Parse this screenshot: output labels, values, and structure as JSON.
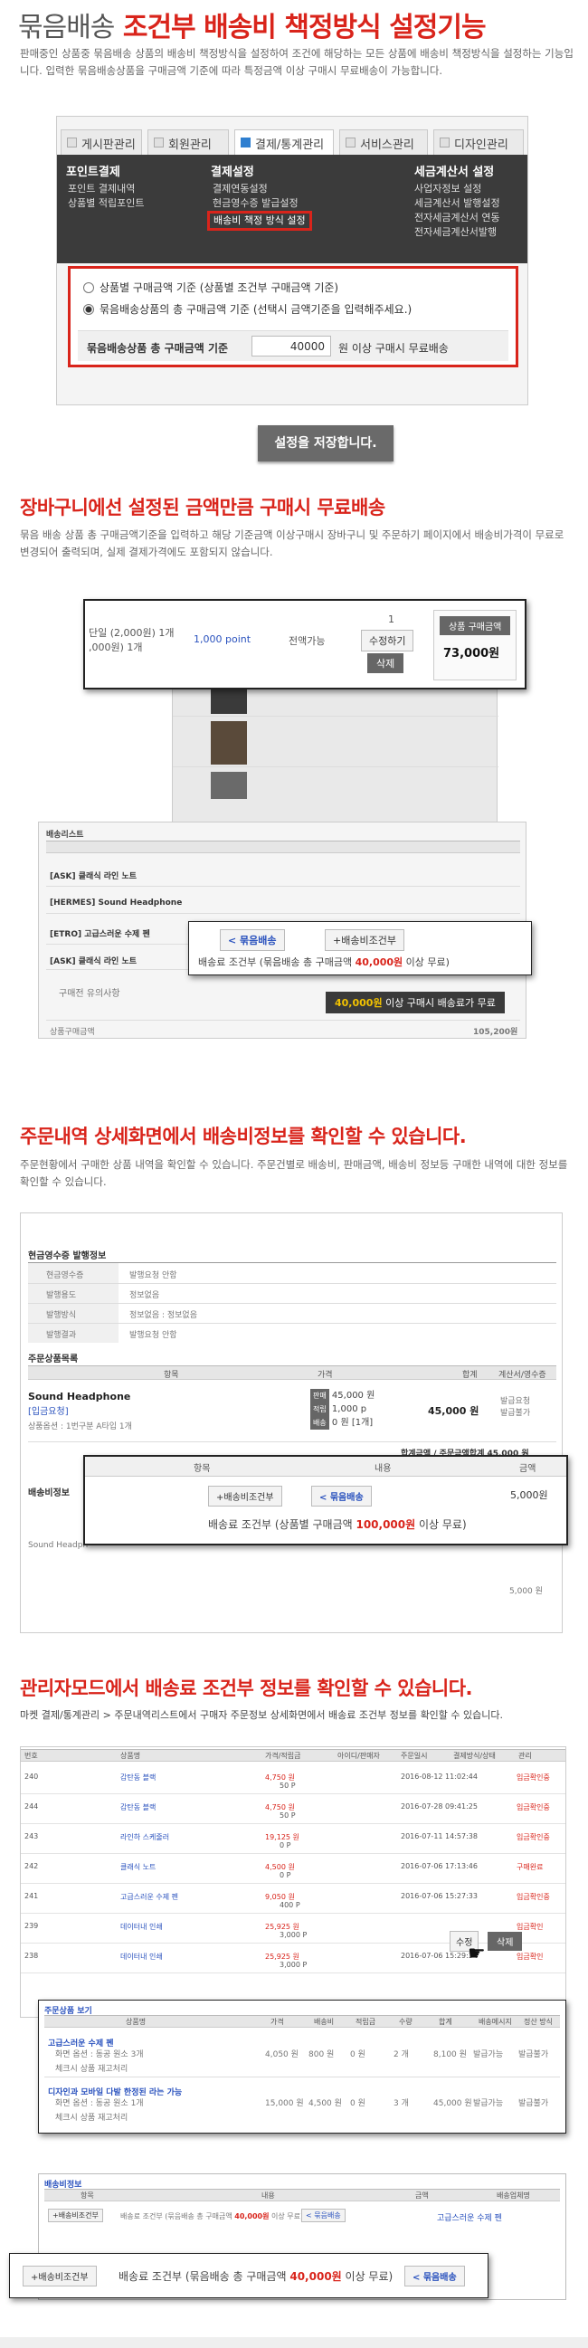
{
  "header": {
    "title_a": "묶음배송",
    "title_b": "조건부 배송비 책정방식 설정기능",
    "intro": "판매중인 상품중 묶음배송 상품의 배송비 책정방식을 설정하여 조건에 해당하는 모든 상품에 배송비 책정방식을 설정하는 기능입니다. 입력한 묶음배송상품을 구매금액 기준에 따라 특정금액 이상 구매시 무료배송이 가능합니다."
  },
  "shot1": {
    "tabs": [
      "게시판관리",
      "회원관리",
      "결제/통계관리",
      "서비스관리",
      "디자인관리"
    ],
    "menu": {
      "col1_title": "포인트결제",
      "col1_items": [
        "포인트 결제내역",
        "상품별 적립포인트"
      ],
      "col2_title": "결제설정",
      "col2_items": [
        "결제연동설정",
        "현금영수증 발급설정",
        "배송비 책정 방식 설정"
      ],
      "col3_title": "세금계산서 설정",
      "col3_items": [
        "사업자정보 설정",
        "세금계산서 발행설정",
        "전자세금계산서 연동",
        "전자세금계산서발행"
      ]
    },
    "option1": "상품별 구매금액 기준 (상품별 조건부 구매금액 기준)",
    "option2": "묶음배송상품의 총 구매금액 기준 (선택시 금액기준을 입력해주세요.)",
    "row_label": "묶음배송상품 총 구매금액 기준",
    "amount": "40000",
    "row_tail": "원 이상 구매시 무료배송",
    "save_button": "설정을 저장합니다."
  },
  "section2": {
    "title": "장바구니에선 설정된 금액만큼 구매시 무료배송",
    "desc": "묶음 배송 상품 총 구매금액기준을 입력하고 해당 기준금액 이상구매시 장바구니 및 주문하기 페이지에서 배송비가격이 무료로 변경되어 출력되며, 실제 결제가격에도 포함되지 않습니다.",
    "popup1": {
      "left_text": "단일 (2,000원) 1개\n,000원) 1개",
      "point": "1,000 point",
      "status": "전액가능",
      "qty": "1",
      "qty_btn": "수정하기",
      "del_btn": "삭제",
      "price_head": "상품 구매금액",
      "price": "73,000원"
    },
    "list_rows": [
      {
        "code": "[ASK] 클래식 라인 노트"
      },
      {
        "code": "[HERMES] Sound Headphone"
      },
      {
        "code": "[ETRO] 고급스러운 수제 펜"
      },
      {
        "code": "[ASK] 클래식 라인 노트"
      }
    ],
    "list_header": "배송리스트",
    "notice_label": "구매전 유의사항",
    "total_label": "상품구매금액",
    "total_value": "105,200원",
    "popup2": {
      "tab1": "< 묶음배송",
      "tab2": "+배송비조건부",
      "text_a": "배송료 조건부 (묶음배송 총 구매금액 ",
      "text_b": "40,000원",
      "text_c": " 이상 무료)",
      "free_a": "40,000원",
      "free_b": " 이상 구매시 배송료가 무료"
    }
  },
  "section3": {
    "title": "주문내역 상세화면에서 배송비정보를 확인할 수 있습니다.",
    "desc": "주문현황에서 구매한 상품 내역을 확인할 수 있습니다. 주문건별로 배송비, 판매금액, 배송비 정보등 구매한 내역에 대한 정보를 확인할 수 있습니다.",
    "receipt_title": "현금영수증 발행정보",
    "receipt_rows": [
      [
        "현금영수증",
        "발행요청 안함"
      ],
      [
        "발행용도",
        "정보없음"
      ],
      [
        "발행방식",
        "정보없음 : 정보없음"
      ],
      [
        "발행결과",
        "발행요청 안함"
      ]
    ],
    "order_title": "주문상품목록",
    "order_heads": [
      "항목",
      "가격",
      "합계",
      "계산서/영수증"
    ],
    "product_name": "Sound Headphone",
    "product_sub": "[입금요청]",
    "product_opt": "상품옵션 : 1번구분 A타입 1개",
    "price_lines": [
      "45,000 원",
      "1,000 p",
      "0 원 [1개]"
    ],
    "price_tags": [
      "판매",
      "적립",
      "배송"
    ],
    "sum": "45,000 원",
    "receipt_state": "발급요청\n발급불가",
    "total_line": "합계금액 / 주문금액합계 45,000 원",
    "ship_label": "배송비정보",
    "ship_prod": "Sound Headph",
    "popup": {
      "heads": [
        "항목",
        "내용",
        "금액"
      ],
      "tag1": "+배송비조건부",
      "tag2": "< 묶음배송",
      "amount": "5,000원",
      "text_a": "배송료 조건부 (상품별 구매금액 ",
      "text_b": "100,000원",
      "text_c": " 이상 무료)",
      "below": "5,000 원"
    }
  },
  "section4": {
    "title": "관리자모드에서 배송료 조건부 정보를 확인할 수 있습니다.",
    "desc": "마켓 결제/통계관리 > 주문내역리스트에서 구매자 주문정보 상세화면에서 배송료 조건부 정보를 확인할 수 있습니다.",
    "list_heads": [
      "번호",
      "상품명",
      "가격/적립금",
      "아이디/판매자",
      "주문일시",
      "결제방식/상태",
      "관리"
    ],
    "rows": [
      {
        "no": "240",
        "name": "감탄동 블랙",
        "price": "4,750 원",
        "pt": "50 P",
        "date": "2016-08-12 11:02:44",
        "status": "입금확인중"
      },
      {
        "no": "244",
        "name": "감탄동 블랙",
        "price": "4,750 원",
        "pt": "50 P",
        "date": "2016-07-28 09:41:25",
        "status": "입금확인중"
      },
      {
        "no": "243",
        "name": "라인하 스케줄러",
        "price": "19,125 원",
        "pt": "0 P",
        "date": "2016-07-11 14:57:38",
        "status": "입금확인중"
      },
      {
        "no": "242",
        "name": "클래식 노트",
        "price": "4,500 원",
        "pt": "0 P",
        "date": "2016-07-06 17:13:46",
        "status": "구매완료"
      },
      {
        "no": "241",
        "name": "고급스러운 수제 펜",
        "price": "9,050 원",
        "pt": "400 P",
        "date": "2016-07-06 15:27:33",
        "status": "입금확인중"
      },
      {
        "no": "239",
        "name": "데이터내 인쇄",
        "price": "25,925 원",
        "pt": "3,000 P",
        "date": "",
        "status": "입금확인"
      },
      {
        "no": "238",
        "name": "데이터내 인쇄",
        "price": "25,925 원",
        "pt": "3,000 P",
        "date": "2016-07-06 15:29:34",
        "status": "입금확인"
      }
    ],
    "edit_btn": "수정",
    "del_btn": "삭제",
    "detail": {
      "title": "주문상품 보기",
      "heads": [
        "상품명",
        "가격",
        "배송비",
        "적립금",
        "수량",
        "합계",
        "배송메시지",
        "정산 방식"
      ],
      "row1": {
        "name": "고급스러운 수제 펜",
        "opt": "화면 옵션 : 동공 원소 3개",
        "price": "4,050 원",
        "ship": "800 원",
        "pt": "0 원",
        "qty": "2 개",
        "sum": "8,100 원",
        "msg": "발급가능",
        "calc": "발급불가"
      },
      "row2": {
        "name": "디자인과 모바일 다발 한정된 라는 가능",
        "opt": "화면 옵션 : 동공 원소 1개",
        "price": "15,000 원",
        "ship": "4,500 원",
        "pt": "0 원",
        "qty": "3 개",
        "sum": "45,000 원",
        "msg": "발급가능",
        "calc": "발급불가"
      },
      "check_label": "체크시 상품 재고처리"
    },
    "ship_info": {
      "title": "배송비정보",
      "heads": [
        "항목",
        "내용",
        "금액",
        "배송업체명"
      ],
      "tag": "+배송비조건부",
      "text_a": "배송료 조건부 (묶음배송 총 구매금액 ",
      "text_b": "40,000원",
      "text_c": " 이상 무료)",
      "tag2": "< 묶음배송",
      "vendor": "고급스러운 수제 펜"
    },
    "popup": {
      "tag1": "+배송비조건부",
      "text_a": "배송료 조건부 (묶음배송 총 구매금액 ",
      "text_b": "40,000원",
      "text_c": " 이상 무료)",
      "tag2": "< 묶음배송"
    }
  }
}
